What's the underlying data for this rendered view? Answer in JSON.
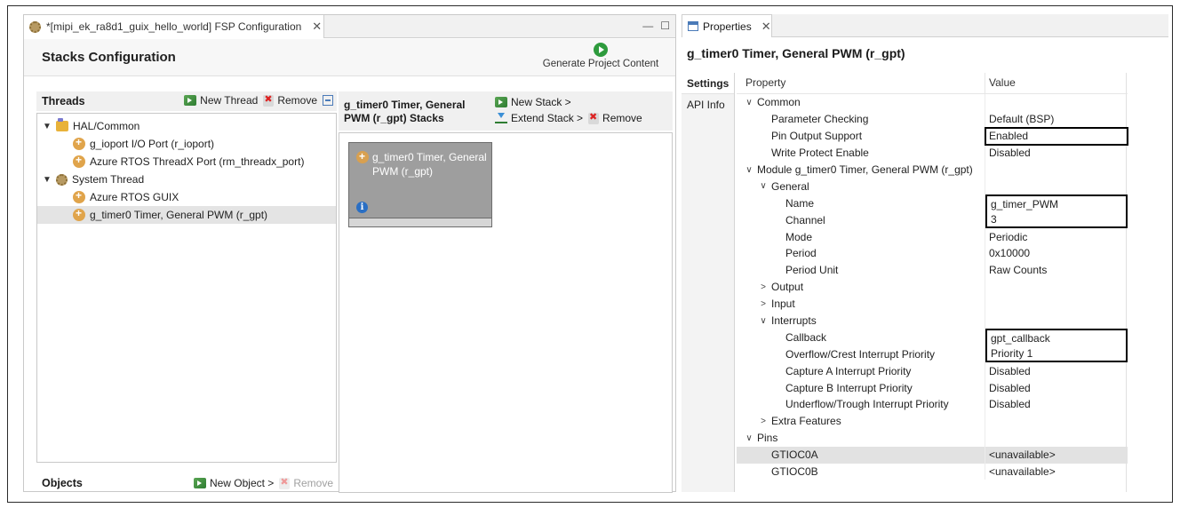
{
  "editor": {
    "tab_title": "*[mipi_ek_ra8d1_guix_hello_world] FSP Configuration",
    "tab_close": "✕",
    "win_min": "—",
    "win_max": "☐",
    "header_title": "Stacks Configuration",
    "generate_label": "Generate Project Content",
    "threads": {
      "label": "Threads",
      "new_label": "New Thread",
      "remove_label": "Remove",
      "tree": [
        {
          "label": "HAL/Common",
          "chev": "▼"
        },
        {
          "label": "g_ioport I/O Port (r_ioport)"
        },
        {
          "label": "Azure RTOS ThreadX Port (rm_threadx_port)"
        },
        {
          "label": "System Thread",
          "chev": "▼"
        },
        {
          "label": "Azure RTOS GUIX"
        },
        {
          "label": "g_timer0 Timer, General PWM (r_gpt)"
        }
      ]
    },
    "objects": {
      "label": "Objects",
      "new_label": "New Object >",
      "remove_label": "Remove"
    },
    "stacks": {
      "title": "g_timer0 Timer, General PWM (r_gpt) Stacks",
      "new_stack": "New Stack >",
      "extend_stack": "Extend Stack >",
      "remove": "Remove",
      "block_label": "g_timer0 Timer, General PWM (r_gpt)",
      "info": "i"
    }
  },
  "properties": {
    "tab_title": "Properties",
    "tab_close": "✕",
    "title": "g_timer0 Timer, General PWM (r_gpt)",
    "side_tabs": [
      "Settings",
      "API Info"
    ],
    "col_property": "Property",
    "col_value": "Value",
    "rows": [
      {
        "name": "Common",
        "value": "",
        "chev": "∨"
      },
      {
        "name": "Parameter Checking",
        "value": "Default (BSP)"
      },
      {
        "name": "Pin Output Support",
        "value": "Enabled"
      },
      {
        "name": "Write Protect Enable",
        "value": "Disabled"
      },
      {
        "name": "Module g_timer0 Timer, General PWM (r_gpt)",
        "value": "",
        "chev": "∨"
      },
      {
        "name": "General",
        "value": "",
        "chev": "∨"
      },
      {
        "name": "Name",
        "value": "g_timer_PWM"
      },
      {
        "name": "Channel",
        "value": "3"
      },
      {
        "name": "Mode",
        "value": "Periodic"
      },
      {
        "name": "Period",
        "value": "0x10000"
      },
      {
        "name": "Period Unit",
        "value": "Raw Counts"
      },
      {
        "name": "Output",
        "value": "",
        "chev": ">"
      },
      {
        "name": "Input",
        "value": "",
        "chev": ">"
      },
      {
        "name": "Interrupts",
        "value": "",
        "chev": "∨"
      },
      {
        "name": "Callback",
        "value": "gpt_callback"
      },
      {
        "name": "Overflow/Crest Interrupt Priority",
        "value": "Priority 1"
      },
      {
        "name": "Capture A Interrupt Priority",
        "value": "Disabled"
      },
      {
        "name": "Capture B Interrupt Priority",
        "value": "Disabled"
      },
      {
        "name": "Underflow/Trough Interrupt Priority",
        "value": "Disabled"
      },
      {
        "name": "Extra Features",
        "value": "",
        "chev": ">"
      },
      {
        "name": "Pins",
        "value": "",
        "chev": "∨"
      },
      {
        "name": "GTIOC0A",
        "value": "<unavailable>"
      },
      {
        "name": "GTIOC0B",
        "value": "<unavailable>"
      }
    ]
  }
}
